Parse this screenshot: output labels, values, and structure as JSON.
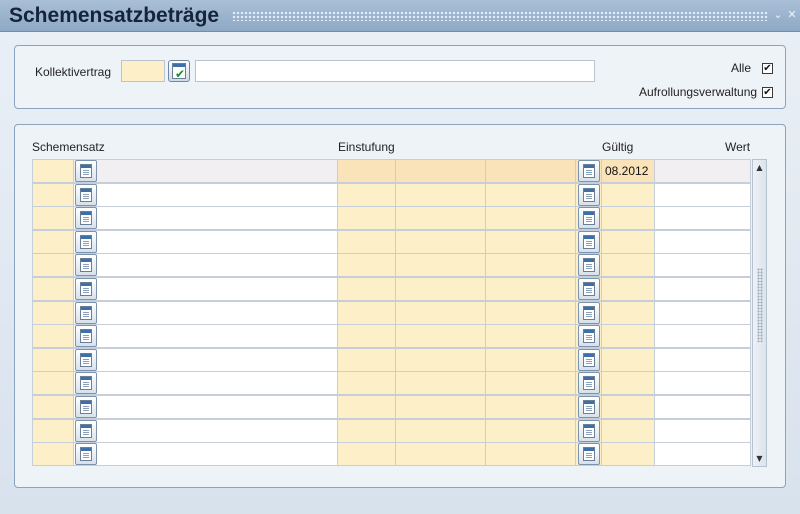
{
  "window": {
    "title": "Schemensatzbeträge",
    "minimize_glyph": "⌄",
    "close_glyph": "✕"
  },
  "filter": {
    "kollektivvertrag_label": "Kollektivertrag",
    "kollektivvertrag_code": "",
    "kollektivvertrag_name": "",
    "alle_label": "Alle",
    "alle_checked": "✔",
    "aufrollung_label": "Aufrollungsverwaltung",
    "aufrollung_checked": "✔"
  },
  "grid": {
    "headers": {
      "schemensatz": "Schemensatz",
      "einstufung": "Einstufung",
      "gueltig": "Gültig",
      "wert": "Wert"
    },
    "rows": [
      {
        "gueltig": "08.2012",
        "wert": ""
      },
      {
        "gueltig": "",
        "wert": ""
      },
      {
        "gueltig": "",
        "wert": ""
      },
      {
        "gueltig": "",
        "wert": ""
      },
      {
        "gueltig": "",
        "wert": ""
      },
      {
        "gueltig": "",
        "wert": ""
      },
      {
        "gueltig": "",
        "wert": ""
      },
      {
        "gueltig": "",
        "wert": ""
      },
      {
        "gueltig": "",
        "wert": ""
      },
      {
        "gueltig": "",
        "wert": ""
      },
      {
        "gueltig": "",
        "wert": ""
      },
      {
        "gueltig": "",
        "wert": ""
      },
      {
        "gueltig": "",
        "wert": ""
      }
    ]
  },
  "colors": {
    "input_yellow": "#fdefc8",
    "titlebar": "#9bb3ce",
    "panel_border": "#8aa3be",
    "check_green": "#1a8a2a"
  }
}
